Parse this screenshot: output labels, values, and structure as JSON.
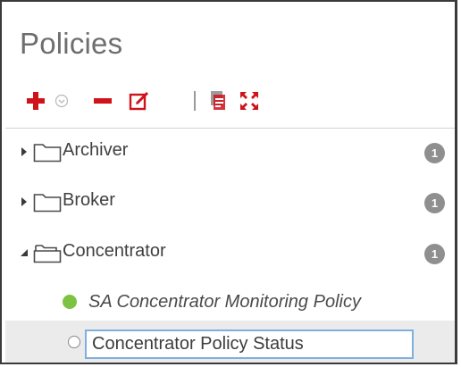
{
  "panel": {
    "title": "Policies"
  },
  "toolbar": {
    "add_icon": "plus-icon",
    "add_menu_icon": "chevron-down-circle-icon",
    "delete_icon": "minus-icon",
    "edit_icon": "edit-icon",
    "copy_icon": "duplicate-icon",
    "expand_icon": "expand-icon"
  },
  "tree": {
    "folders": [
      {
        "label": "Archiver",
        "count": "1",
        "expanded": false
      },
      {
        "label": "Broker",
        "count": "1",
        "expanded": false
      },
      {
        "label": "Concentrator",
        "count": "1",
        "expanded": true
      }
    ],
    "policies": [
      {
        "label": "SA Concentrator Monitoring Policy",
        "status": "enabled",
        "status_color": "#7dc242"
      }
    ],
    "new_policy": {
      "value": "Concentrator Policy Status",
      "status": "disabled"
    }
  },
  "colors": {
    "accent_red": "#d0121b",
    "selection_border": "#7fb0dd",
    "badge": "#8f8f8f"
  }
}
